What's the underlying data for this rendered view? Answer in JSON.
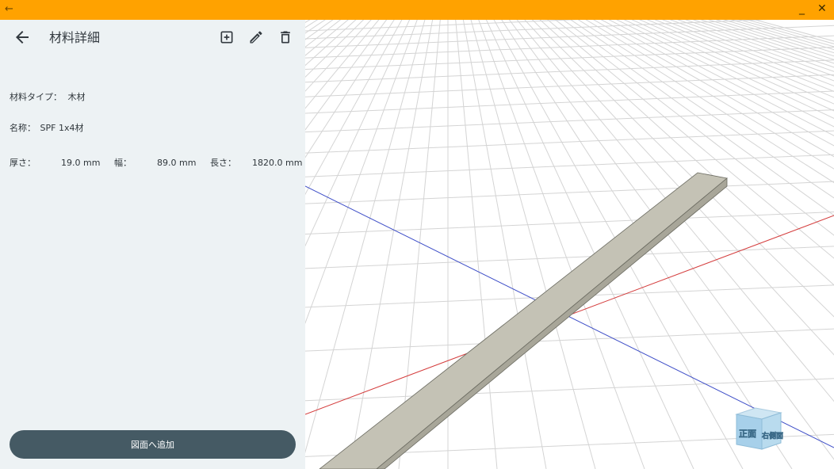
{
  "window": {
    "back_glyph": "←",
    "minimize_glyph": "_",
    "close_glyph": "✕",
    "accent": "#ffa200"
  },
  "appbar": {
    "title": "材料詳細",
    "back_icon": "arrow-left-icon",
    "actions": [
      "add-box-icon",
      "pencil-icon",
      "trash-icon"
    ]
  },
  "details": {
    "type_label": "材料タイプ：",
    "type_value": "木材",
    "name_label": "名称：",
    "name_value": "SPF 1x4材",
    "thickness_label": "厚さ：",
    "thickness_value": "19.0 mm",
    "width_label": "幅：",
    "width_value": "89.0 mm",
    "length_label": "長さ：",
    "length_value": "1820.0 mm"
  },
  "add_button": {
    "label": "図面へ追加",
    "color": "#455a64"
  },
  "view_cube": {
    "front_label": "正面",
    "right_label": "右側面"
  }
}
